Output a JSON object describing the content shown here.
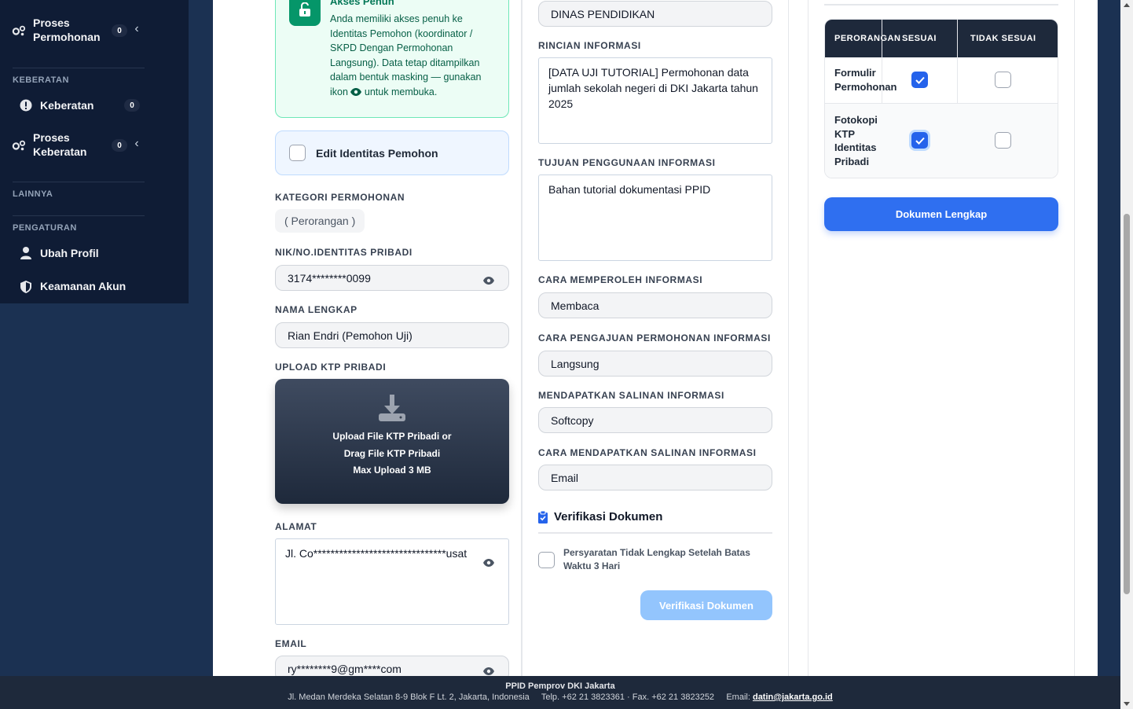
{
  "sidebar": {
    "proses_permohonan": {
      "label_line1": "Proses",
      "label_line2": "Permohonan",
      "badge": "0"
    },
    "keberatan_section": "KEBERATAN",
    "keberatan": {
      "label": "Keberatan",
      "badge": "0"
    },
    "proses_keberatan": {
      "label_line1": "Proses",
      "label_line2": "Keberatan",
      "badge": "0"
    },
    "lainnya_section": "LAINNYA",
    "pengaturan_section": "PENGATURAN",
    "ubah_profil": "Ubah Profil",
    "keamanan_akun": "Keamanan Akun"
  },
  "alert": {
    "title": "Akses Penuh",
    "text": "Anda memiliki akses penuh ke Identitas Pemohon (koordinator / SKPD Dengan Permohonan Langsung). Data tetap ditampilkan dalam bentuk masking — gunakan ikon",
    "text_suffix": "untuk membuka."
  },
  "edit_identitas": "Edit Identitas Pemohon",
  "kategori": {
    "label": "KATEGORI PERMOHONAN",
    "value": "( Perorangan )"
  },
  "nik": {
    "label": "NIK/NO.IDENTITAS PRIBADI",
    "value": "3174********0099"
  },
  "nama": {
    "label": "NAMA LENGKAP",
    "value": "Rian Endri (Pemohon Uji)"
  },
  "upload": {
    "label": "UPLOAD KTP PRIBADI",
    "line1": "Upload File KTP Pribadi or",
    "line2": "Drag File KTP Pribadi",
    "line3": "Max Upload 3 MB"
  },
  "alamat": {
    "label": "ALAMAT",
    "value": "Jl. Co*******************************usat"
  },
  "email": {
    "label": "EMAIL",
    "value": "ry********9@gm****com"
  },
  "skpd": {
    "value": "DINAS PENDIDIKAN"
  },
  "rincian": {
    "label": "RINCIAN INFORMASI",
    "value": "[DATA UJI TUTORIAL] Permohonan data jumlah sekolah negeri di DKI Jakarta tahun 2025"
  },
  "tujuan": {
    "label": "TUJUAN PENGGUNAAN INFORMASI",
    "value": "Bahan tutorial dokumentasi PPID"
  },
  "cara_memperoleh": {
    "label": "CARA MEMPEROLEH INFORMASI",
    "value": "Membaca"
  },
  "cara_pengajuan": {
    "label": "CARA PENGAJUAN PERMOHONAN INFORMASI",
    "value": "Langsung"
  },
  "salinan": {
    "label": "MENDAPATKAN SALINAN INFORMASI",
    "value": "Softcopy"
  },
  "cara_salinan": {
    "label": "CARA MENDAPATKAN SALINAN INFORMASI",
    "value": "Email"
  },
  "verifikasi": {
    "title": "Verifikasi Dokumen",
    "check_line1": "Persyaratan Tidak Lengkap Setelah Batas",
    "check_line2": "Waktu 3 Hari",
    "button": "Verifikasi Dokumen"
  },
  "doc_table": {
    "headers": [
      "PERORANGAN",
      "SESUAI",
      "TIDAK SESUAI"
    ],
    "rows": [
      {
        "line1": "Formulir",
        "line2": "Permohonan",
        "sesuai": true,
        "tidak_sesuai": false
      },
      {
        "line1": "Fotokopi",
        "line2": "KTP",
        "line3": "Identitas",
        "line4": "Pribadi",
        "sesuai": true,
        "tidak_sesuai": false
      }
    ]
  },
  "dokumen_lengkap": "Dokumen Lengkap",
  "footer": {
    "org": "PPID Pemprov DKI Jakarta",
    "address": "Jl. Medan Merdeka Selatan 8-9 Blok F Lt. 2, Jakarta, Indonesia",
    "phone": "Telp. +62 21 3823361 · Fax. +62 21 3823252",
    "email_label": "Email:",
    "email": "datin@jakarta.go.id"
  },
  "colors": {
    "primary": "#2f6ff0",
    "sidebar": "#0f1c35",
    "success": "#059669"
  }
}
